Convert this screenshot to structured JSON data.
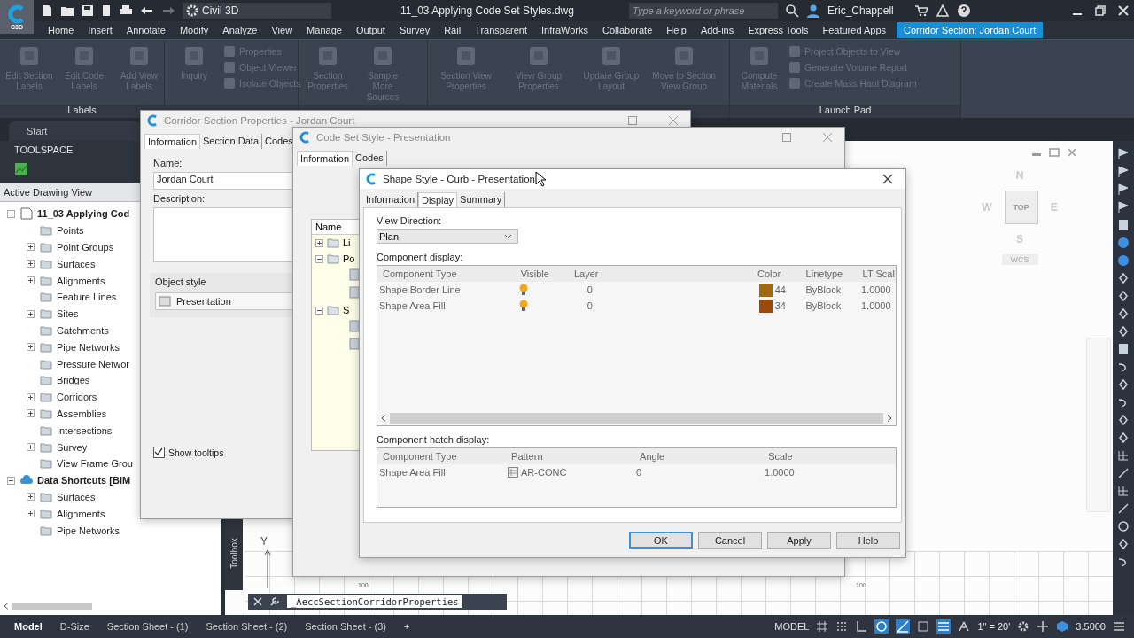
{
  "title_bar": {
    "app_badge": "C3D",
    "workspace": "Civil 3D",
    "document_title": "11_03 Applying Code Set Styles.dwg",
    "search": {
      "placeholder": "Type a keyword or phrase"
    },
    "user": "Eric_Chappell"
  },
  "menu_tabs": [
    {
      "label": "Home",
      "selected": false
    },
    {
      "label": "Insert",
      "selected": false
    },
    {
      "label": "Annotate",
      "selected": false
    },
    {
      "label": "Modify",
      "selected": false
    },
    {
      "label": "Analyze",
      "selected": false
    },
    {
      "label": "View",
      "selected": false
    },
    {
      "label": "Manage",
      "selected": false
    },
    {
      "label": "Output",
      "selected": false
    },
    {
      "label": "Survey",
      "selected": false
    },
    {
      "label": "Rail",
      "selected": false
    },
    {
      "label": "Transparent",
      "selected": false
    },
    {
      "label": "InfraWorks",
      "selected": false
    },
    {
      "label": "Collaborate",
      "selected": false
    },
    {
      "label": "Help",
      "selected": false
    },
    {
      "label": "Add-ins",
      "selected": false
    },
    {
      "label": "Express Tools",
      "selected": false
    },
    {
      "label": "Featured Apps",
      "selected": false
    },
    {
      "label": "Corridor Section: Jordan Court",
      "selected": true
    }
  ],
  "ribbon": {
    "panels": [
      {
        "title": "Labels",
        "large_buttons": [
          {
            "label": "Edit Section Labels",
            "disabled": true
          },
          {
            "label": "Edit Code Labels",
            "disabled": true
          },
          {
            "label": "Add View Labels",
            "disabled": true
          }
        ]
      },
      {
        "large_buttons": [
          {
            "label": "Inquiry",
            "disabled": true
          }
        ],
        "small_buttons": [
          {
            "label": "Properties",
            "disabled": true
          },
          {
            "label": "Object Viewer",
            "disabled": true
          },
          {
            "label": "Isolate Objects",
            "disabled": true
          }
        ]
      },
      {
        "large_buttons": [
          {
            "label": "Section Properties",
            "disabled": true
          },
          {
            "label": "Sample More Sources",
            "disabled": true
          }
        ]
      },
      {
        "large_buttons": [
          {
            "label": "Section View Properties",
            "disabled": true
          },
          {
            "label": "View Group Properties",
            "disabled": true
          },
          {
            "label": "Update Group Layout",
            "disabled": true
          },
          {
            "label": "Move to Section View Group",
            "disabled": true
          }
        ]
      },
      {
        "title": "Launch Pad",
        "large_buttons": [
          {
            "label": "Compute Materials",
            "disabled": true
          }
        ],
        "small_buttons": [
          {
            "label": "Project Objects to View",
            "disabled": true
          },
          {
            "label": "Generate Volume Report",
            "disabled": true
          },
          {
            "label": "Create Mass Haul Diagram",
            "disabled": true
          }
        ]
      }
    ]
  },
  "doc_tabs": [
    {
      "label": "Start",
      "selected": false
    }
  ],
  "toolspace": {
    "title": "TOOLSPACE",
    "view": "Active Drawing View",
    "tree": [
      {
        "label": "11_03 Applying Cod",
        "kind": "drawing",
        "expanded": true,
        "children": [
          {
            "label": "Points",
            "kind": "category"
          },
          {
            "label": "Point Groups",
            "kind": "category",
            "expanded": false
          },
          {
            "label": "Surfaces",
            "kind": "category",
            "expanded": false
          },
          {
            "label": "Alignments",
            "kind": "category",
            "expanded": false
          },
          {
            "label": "Feature Lines",
            "kind": "category"
          },
          {
            "label": "Sites",
            "kind": "category",
            "expanded": false
          },
          {
            "label": "Catchments",
            "kind": "category"
          },
          {
            "label": "Pipe Networks",
            "kind": "category",
            "expanded": false
          },
          {
            "label": "Pressure Networ",
            "kind": "category"
          },
          {
            "label": "Bridges",
            "kind": "category"
          },
          {
            "label": "Corridors",
            "kind": "category",
            "expanded": false
          },
          {
            "label": "Assemblies",
            "kind": "category",
            "expanded": false
          },
          {
            "label": "Intersections",
            "kind": "category"
          },
          {
            "label": "Survey",
            "kind": "category",
            "expanded": false
          },
          {
            "label": "View Frame Grou",
            "kind": "category"
          }
        ]
      },
      {
        "label": "Data Shortcuts [BIM",
        "kind": "shortcuts",
        "expanded": true,
        "children": [
          {
            "label": "Surfaces",
            "kind": "category",
            "expanded": false
          },
          {
            "label": "Alignments",
            "kind": "category",
            "expanded": false
          },
          {
            "label": "Pipe Networks",
            "kind": "category"
          }
        ]
      }
    ]
  },
  "drawing": {
    "viewcube": {
      "north": "N",
      "west": "W",
      "top": "TOP",
      "east": "E",
      "south": "S",
      "ucs": "WCS"
    },
    "axis_label": "Y",
    "grid_labels": [
      "100",
      "100"
    ],
    "toolbox_tab": "Toolbox"
  },
  "command_line": {
    "text": "_AeccSectionCorridorProperties"
  },
  "status_bar": {
    "layout_tabs": [
      {
        "label": "Model",
        "selected": true
      },
      {
        "label": "D-Size",
        "selected": false
      },
      {
        "label": "Section Sheet - (1)",
        "selected": false
      },
      {
        "label": "Section Sheet - (2)",
        "selected": false
      },
      {
        "label": "Section Sheet - (3)",
        "selected": false
      }
    ],
    "add_tab": "+",
    "space": "MODEL",
    "scale": "1\" = 20'",
    "value": "3.5000"
  },
  "corridor_dialog": {
    "title": "Corridor Section Properties - Jordan Court",
    "tabs": [
      {
        "label": "Information",
        "selected": true
      },
      {
        "label": "Section Data",
        "selected": false
      },
      {
        "label": "Codes",
        "selected": false
      }
    ],
    "name_label": "Name:",
    "name_value": "Jordan Court",
    "description_label": "Description:",
    "object_style_label": "Object style",
    "object_style": "Presentation",
    "show_tooltips": {
      "label": "Show tooltips",
      "checked": true
    }
  },
  "code_set_dialog": {
    "title": "Code Set Style - Presentation",
    "tabs": [
      {
        "label": "Information",
        "selected": true
      },
      {
        "label": "Codes",
        "selected": false
      }
    ],
    "tree_header": "Name",
    "tree": [
      {
        "label": "Li",
        "expanded": false
      },
      {
        "label": "Po",
        "expanded": true
      },
      {
        "label": "S",
        "expanded": true
      }
    ]
  },
  "shape_dialog": {
    "title": "Shape Style - Curb - Presentation",
    "tabs": [
      {
        "label": "Information",
        "selected": false
      },
      {
        "label": "Display",
        "selected": true
      },
      {
        "label": "Summary",
        "selected": false
      }
    ],
    "view_direction_label": "View Direction:",
    "view_direction": "Plan",
    "component_display_label": "Component display:",
    "columns": [
      "Component Type",
      "Visible",
      "Layer",
      "Color",
      "Linetype",
      "LT Scal"
    ],
    "rows": [
      {
        "type": "Shape Border Line",
        "visible": true,
        "layer": "0",
        "color": "#a0690f",
        "color_name": "44",
        "linetype": "ByBlock",
        "lt_scale": "1.0000"
      },
      {
        "type": "Shape Area Fill",
        "visible": true,
        "layer": "0",
        "color": "#9a4a0b",
        "color_name": "34",
        "linetype": "ByBlock",
        "lt_scale": "1.0000"
      }
    ],
    "hatch_label": "Component hatch display:",
    "hatch_columns": [
      "Component Type",
      "Pattern",
      "Angle",
      "Scale"
    ],
    "hatch_rows": [
      {
        "type": "Shape Area Fill",
        "pattern": "AR-CONC",
        "angle": "0",
        "scale": "1.0000"
      }
    ],
    "buttons": [
      {
        "label": "OK",
        "default": true
      },
      {
        "label": "Cancel",
        "default": false
      },
      {
        "label": "Apply",
        "default": false
      },
      {
        "label": "Help",
        "default": false
      }
    ]
  }
}
